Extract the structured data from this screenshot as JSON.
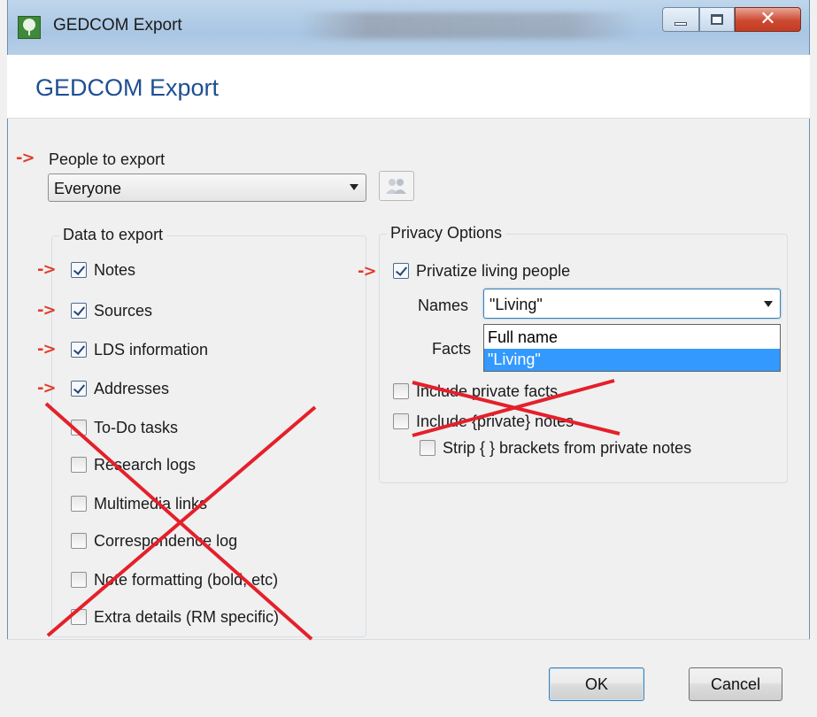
{
  "window": {
    "title": "GEDCOM Export",
    "header_title": "GEDCOM Export"
  },
  "people": {
    "label": "People to export",
    "selected": "Everyone"
  },
  "data_group": {
    "title": "Data to export",
    "items": [
      {
        "label": "Notes",
        "checked": true
      },
      {
        "label": "Sources",
        "checked": true
      },
      {
        "label": "LDS information",
        "checked": true
      },
      {
        "label": "Addresses",
        "checked": true
      },
      {
        "label": "To-Do tasks",
        "checked": false
      },
      {
        "label": "Research logs",
        "checked": false
      },
      {
        "label": "Multimedia links",
        "checked": false
      },
      {
        "label": "Correspondence log",
        "checked": false
      },
      {
        "label": "Note formatting (bold, etc)",
        "checked": false
      },
      {
        "label": "Extra details (RM specific)",
        "checked": false
      }
    ]
  },
  "privacy_group": {
    "title": "Privacy Options",
    "privatize_label": "Privatize living people",
    "privatize_checked": true,
    "names_label": "Names",
    "names_selected": "\"Living\"",
    "names_options": [
      "Full name",
      "\"Living\""
    ],
    "facts_label": "Facts",
    "include_private_facts": "Include private facts",
    "include_private_notes": "Include {private} notes",
    "strip_brackets": "Strip { } brackets from private notes"
  },
  "annotation": {
    "arrow": "->",
    "color": "#e03b2a"
  },
  "buttons": {
    "ok": "OK",
    "cancel": "Cancel"
  }
}
